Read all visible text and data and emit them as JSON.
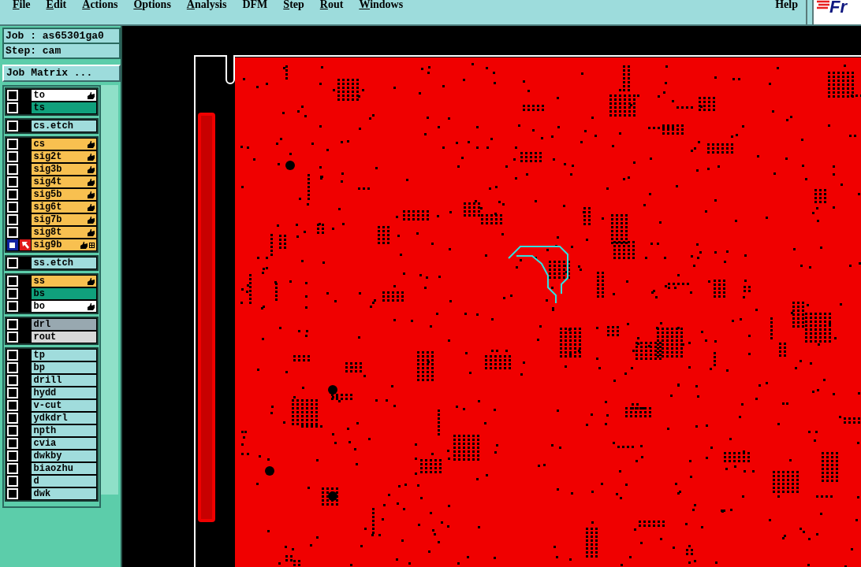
{
  "menu": [
    {
      "label": "File",
      "mnemonic": true
    },
    {
      "label": "Edit",
      "mnemonic": true
    },
    {
      "label": "Actions",
      "mnemonic": true
    },
    {
      "label": "Options",
      "mnemonic": true
    },
    {
      "label": "Analysis",
      "mnemonic": true
    },
    {
      "label": "DFM",
      "mnemonic": false
    },
    {
      "label": "Step",
      "mnemonic": true
    },
    {
      "label": "Rout",
      "mnemonic": true
    },
    {
      "label": "Windows",
      "mnemonic": true
    }
  ],
  "help": "Help",
  "logo": "Fr",
  "job": "Job : as65301ga0",
  "step": "Step: cam",
  "job_matrix_button": "Job Matrix ...",
  "layer_groups": [
    {
      "layers": [
        {
          "name": "to",
          "color": "#ffffff",
          "affected": true,
          "selected": false,
          "marked": false
        },
        {
          "name": "ts",
          "color": "#10a07c",
          "affected": false,
          "selected": false,
          "marked": false
        }
      ]
    },
    {
      "layers": [
        {
          "name": "cs.etch",
          "color": "#a0dcdc",
          "affected": false,
          "selected": false,
          "marked": false
        }
      ]
    },
    {
      "layers": [
        {
          "name": "cs",
          "color": "#f8c050",
          "affected": true,
          "selected": false,
          "marked": false
        },
        {
          "name": "sig2t",
          "color": "#f8c050",
          "affected": true,
          "selected": false,
          "marked": false
        },
        {
          "name": "sig3b",
          "color": "#f8c050",
          "affected": true,
          "selected": false,
          "marked": false
        },
        {
          "name": "sig4t",
          "color": "#f8c050",
          "affected": true,
          "selected": false,
          "marked": false
        },
        {
          "name": "sig5b",
          "color": "#f8c050",
          "affected": true,
          "selected": false,
          "marked": false
        },
        {
          "name": "sig6t",
          "color": "#f8c050",
          "affected": true,
          "selected": false,
          "marked": false
        },
        {
          "name": "sig7b",
          "color": "#f8c050",
          "affected": true,
          "selected": false,
          "marked": false
        },
        {
          "name": "sig8t",
          "color": "#f8c050",
          "affected": true,
          "selected": false,
          "marked": false
        },
        {
          "name": "sig9b",
          "color": "#f8c050",
          "affected": true,
          "selected": true,
          "marked": true
        }
      ]
    },
    {
      "layers": [
        {
          "name": "ss.etch",
          "color": "#a0dcdc",
          "affected": false,
          "selected": false,
          "marked": false
        }
      ]
    },
    {
      "layers": [
        {
          "name": "ss",
          "color": "#f8c050",
          "affected": true,
          "selected": false,
          "marked": false
        },
        {
          "name": "bs",
          "color": "#10a07c",
          "affected": false,
          "selected": false,
          "marked": false
        },
        {
          "name": "bo",
          "color": "#ffffff",
          "affected": true,
          "selected": false,
          "marked": false
        }
      ]
    },
    {
      "layers": [
        {
          "name": "drl",
          "color": "#98a8b0",
          "affected": false,
          "selected": false,
          "marked": false
        },
        {
          "name": "rout",
          "color": "#d8d8d8",
          "affected": false,
          "selected": false,
          "marked": false
        }
      ]
    },
    {
      "layers": [
        {
          "name": "tp",
          "color": "#a0dcdc",
          "affected": false,
          "selected": false,
          "marked": false
        },
        {
          "name": "bp",
          "color": "#a0dcdc",
          "affected": false,
          "selected": false,
          "marked": false
        },
        {
          "name": "drill",
          "color": "#a0dcdc",
          "affected": false,
          "selected": false,
          "marked": false
        },
        {
          "name": "hydd",
          "color": "#a0dcdc",
          "affected": false,
          "selected": false,
          "marked": false
        },
        {
          "name": "v-cut",
          "color": "#a0dcdc",
          "affected": false,
          "selected": false,
          "marked": false
        },
        {
          "name": "ydkdrl",
          "color": "#a0dcdc",
          "affected": false,
          "selected": false,
          "marked": false
        },
        {
          "name": "npth",
          "color": "#a0dcdc",
          "affected": false,
          "selected": false,
          "marked": false
        },
        {
          "name": "cvia",
          "color": "#a0dcdc",
          "affected": false,
          "selected": false,
          "marked": false
        },
        {
          "name": "dwkby",
          "color": "#a0dcdc",
          "affected": false,
          "selected": false,
          "marked": false
        },
        {
          "name": "biaozhu",
          "color": "#a0dcdc",
          "affected": false,
          "selected": false,
          "marked": false
        },
        {
          "name": "d",
          "color": "#a0dcdc",
          "affected": false,
          "selected": false,
          "marked": false
        },
        {
          "name": "dwk",
          "color": "#a0dcdc",
          "affected": false,
          "selected": false,
          "marked": false
        }
      ]
    }
  ]
}
